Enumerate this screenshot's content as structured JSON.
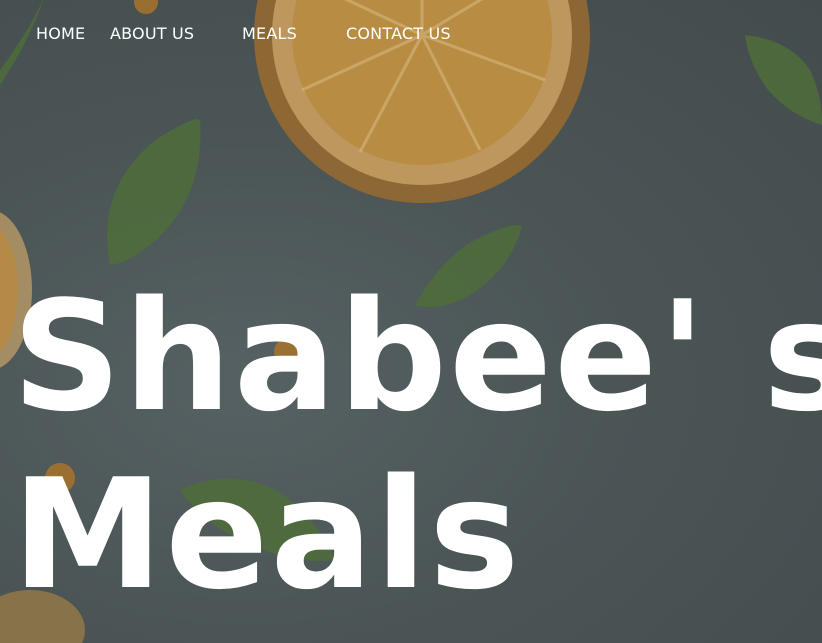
{
  "nav": {
    "items": [
      {
        "label": "HOME"
      },
      {
        "label": "ABOUT US"
      },
      {
        "label": "MEALS"
      },
      {
        "label": "CONTACT US"
      }
    ]
  },
  "hero": {
    "title_line1": "Shabee' s",
    "title_line2": "Meals"
  },
  "colors": {
    "overlay": "#4a5354",
    "text": "#ffffff",
    "orange": "#e9a23b",
    "leaf": "#4f6b3c"
  }
}
